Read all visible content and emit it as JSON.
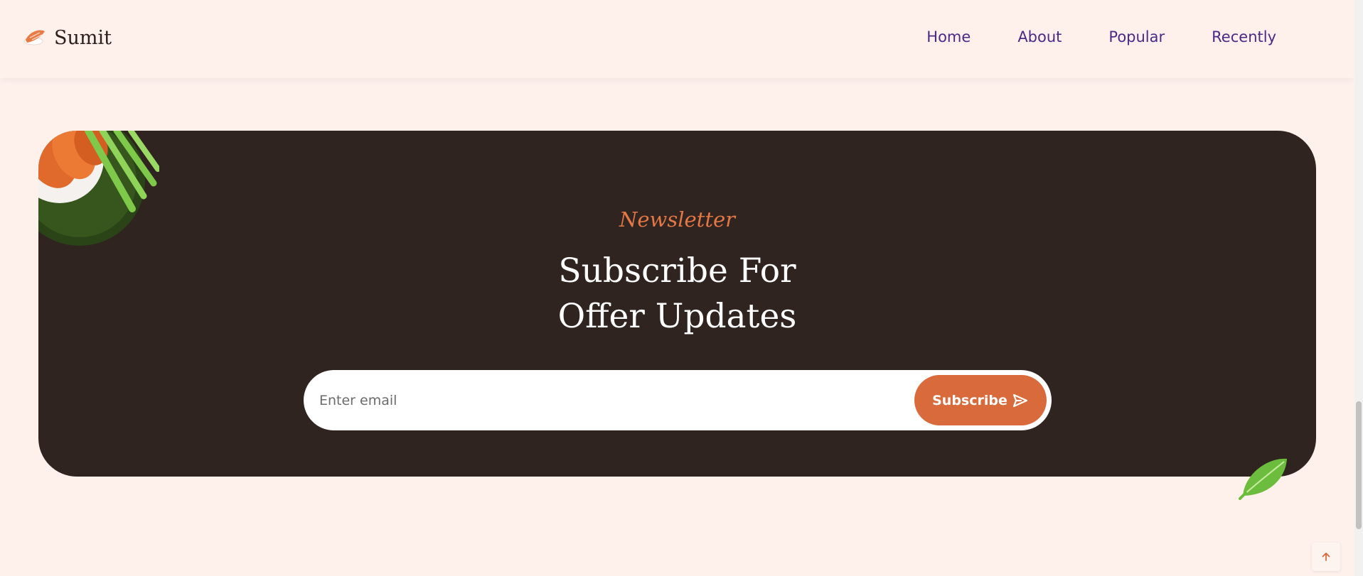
{
  "brand": {
    "name": "Sumit",
    "icon": "sushi-logo-icon"
  },
  "nav": {
    "items": [
      {
        "label": "Home"
      },
      {
        "label": "About"
      },
      {
        "label": "Popular"
      },
      {
        "label": "Recently"
      }
    ]
  },
  "newsletter": {
    "subtitle": "Newsletter",
    "title_line1": "Subscribe For",
    "title_line2": "Offer Updates",
    "email_placeholder": "Enter email",
    "button_label": "Subscribe",
    "button_icon": "send-icon"
  },
  "colors": {
    "background": "#fef0eb",
    "card": "#2f2420",
    "accent": "#d86a3c",
    "nav_link": "#4a2a86"
  },
  "scroll_up": {
    "icon": "arrow-up-icon"
  }
}
